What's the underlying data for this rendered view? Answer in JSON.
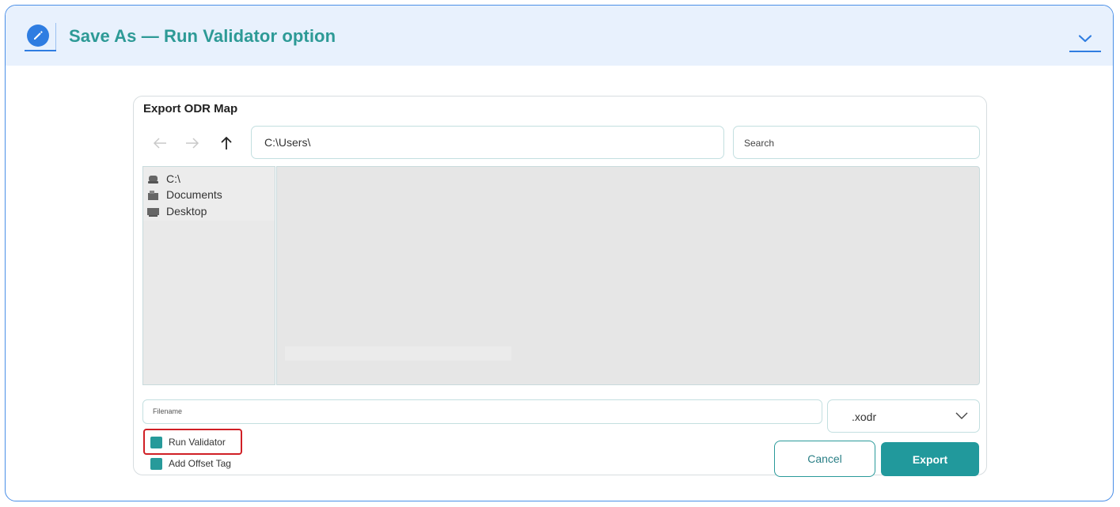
{
  "card": {
    "title": "Save As — Run Validator option",
    "accent_color": "#2d9a96",
    "header_color": "#e8f1fd",
    "badge_icon": "pencil-icon",
    "toggle_icon": "chevron-down-icon"
  },
  "dialog": {
    "title": "Export ODR Map",
    "nav": {
      "back_icon": "arrow-left-icon",
      "forward_icon": "arrow-right-icon",
      "up_icon": "arrow-up-icon"
    },
    "path": "C:\\Users\\",
    "search_placeholder": "Search",
    "sidebar_items": [
      {
        "label": "C:\\",
        "icon": "drive-icon"
      },
      {
        "label": "Documents",
        "icon": "documents-icon"
      },
      {
        "label": "Desktop",
        "icon": "desktop-icon"
      }
    ],
    "filename_placeholder": "Filename",
    "file_type": ".xodr",
    "options": [
      {
        "label": "Run Validator",
        "checked": true
      },
      {
        "label": "Add Offset Tag",
        "checked": true
      }
    ],
    "cancel_label": "Cancel",
    "export_label": "Export",
    "primary_color": "#21999c",
    "highlight_color": "#d01f25"
  }
}
